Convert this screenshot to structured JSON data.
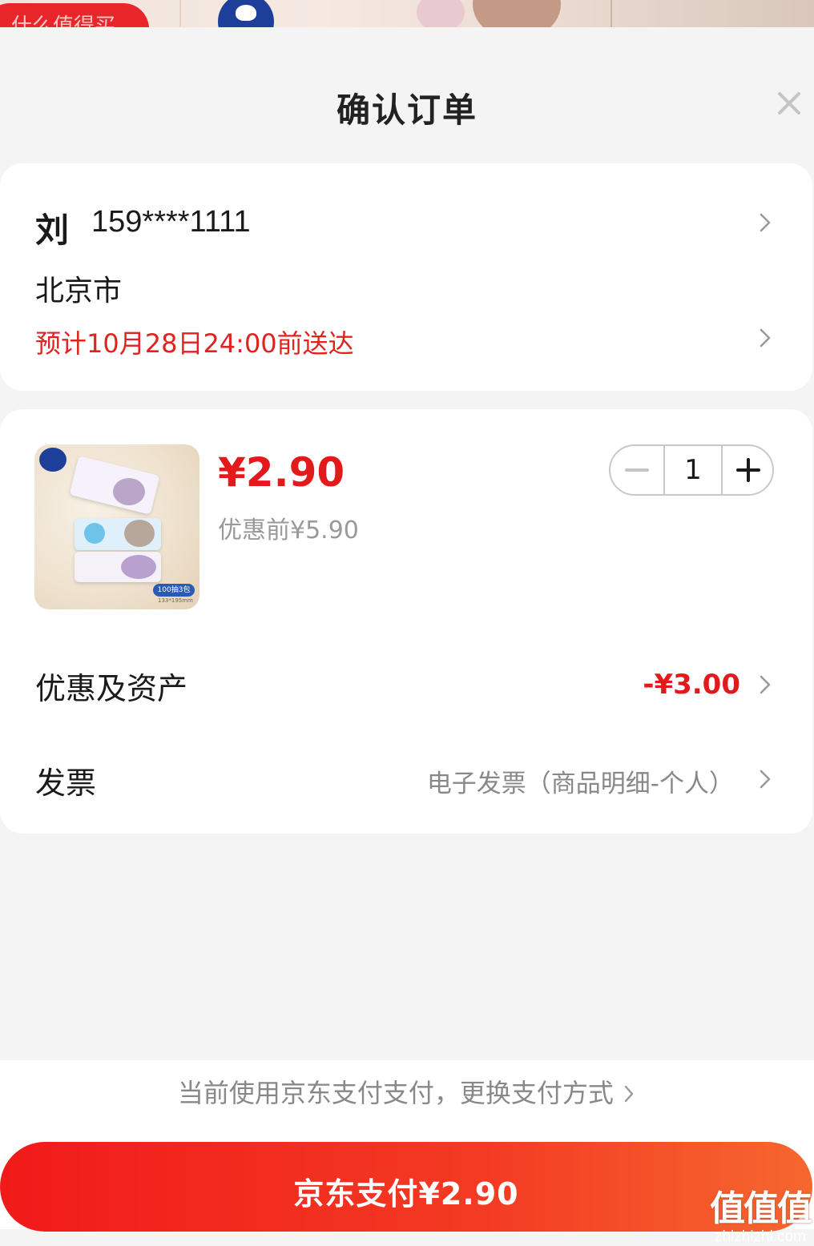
{
  "background": {
    "pill_text": "什么值得买"
  },
  "header": {
    "title": "确认订单",
    "close_icon": "close-icon"
  },
  "address": {
    "name": "刘",
    "phone": "159****1111",
    "city": "北京市",
    "eta": "预计10月28日24:00前送达"
  },
  "product": {
    "price": "¥2.90",
    "original_price": "优惠前¥5.90",
    "quantity": "1",
    "image_tag": "100抽3包",
    "image_size": "133*195mm"
  },
  "rows": {
    "discount_label": "优惠及资产",
    "discount_value": "-¥3.00",
    "invoice_label": "发票",
    "invoice_value": "电子发票（商品明细-个人）"
  },
  "footer": {
    "payment_method": "当前使用京东支付支付，更换支付方式",
    "pay_button": "京东支付¥2.90"
  },
  "watermark": {
    "big": "值值值",
    "small": "zhizhizhi.com"
  },
  "colors": {
    "accent_red": "#e4191c",
    "eta_red": "#e0231f",
    "button_start": "#f11a1a",
    "button_end": "#f6672f"
  }
}
